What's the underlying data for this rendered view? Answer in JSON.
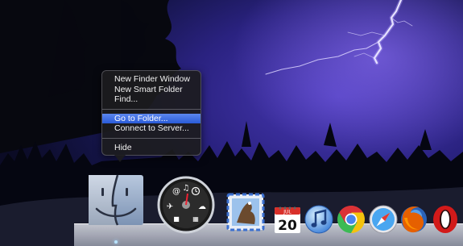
{
  "context_menu": {
    "items": [
      {
        "label": "New Finder Window"
      },
      {
        "label": "New Smart Folder"
      },
      {
        "label": "Find..."
      },
      {
        "label": "Go to Folder..."
      },
      {
        "label": "Connect to Server..."
      },
      {
        "label": "Hide"
      }
    ],
    "selected": "Go to Folder..."
  },
  "dock": {
    "items": [
      {
        "name": "Finder",
        "icon": "finder-icon",
        "running": true
      },
      {
        "name": "Dashboard",
        "icon": "dashboard-icon",
        "running": false
      },
      {
        "name": "Mail",
        "icon": "mail-icon",
        "running": false
      },
      {
        "name": "iCal",
        "icon": "calendar-icon",
        "running": false
      },
      {
        "name": "iTunes",
        "icon": "itunes-icon",
        "running": false
      },
      {
        "name": "Google Chrome",
        "icon": "chrome-icon",
        "running": false
      },
      {
        "name": "Safari",
        "icon": "safari-icon",
        "running": false
      },
      {
        "name": "Firefox",
        "icon": "firefox-icon",
        "running": false
      },
      {
        "name": "Opera",
        "icon": "opera-icon",
        "running": false
      }
    ],
    "calendar": {
      "month": "JUL",
      "day": "20"
    }
  },
  "colors": {
    "menu_highlight": "#3a6ee6",
    "sky": "#2a2280",
    "lightning": "#e8e4ff"
  }
}
